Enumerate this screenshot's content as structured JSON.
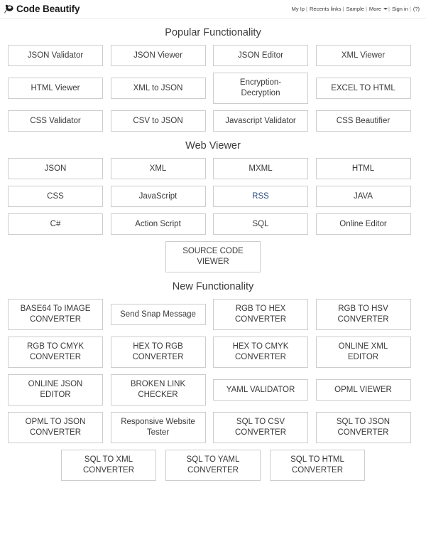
{
  "header": {
    "brand": "Code Beautify",
    "logo_icon": "paw-speech-bubble-icon",
    "nav": [
      {
        "label": "My Ip",
        "sep": "|"
      },
      {
        "label": "Recents links",
        "sep": "|"
      },
      {
        "label": "Sample",
        "sep": "|"
      },
      {
        "label": "More",
        "sep": "|",
        "caret": true
      },
      {
        "label": "Sign in",
        "sep": "|"
      },
      {
        "label": "(?)",
        "sep": ""
      }
    ]
  },
  "sections": [
    {
      "title": "Popular Functionality",
      "rows": [
        {
          "align": "left",
          "items": [
            {
              "label": "JSON Validator",
              "lines": 1
            },
            {
              "label": "JSON Viewer",
              "lines": 1
            },
            {
              "label": "JSON Editor",
              "lines": 1
            },
            {
              "label": "XML Viewer",
              "lines": 1
            }
          ]
        },
        {
          "align": "left",
          "items": [
            {
              "label": "HTML Viewer",
              "lines": 1
            },
            {
              "label": "XML to JSON",
              "lines": 1
            },
            {
              "label": "Encryption-\nDecryption",
              "lines": 2
            },
            {
              "label": "EXCEL TO HTML",
              "lines": 1
            }
          ]
        },
        {
          "align": "left",
          "items": [
            {
              "label": "CSS Validator",
              "lines": 1
            },
            {
              "label": "CSV to JSON",
              "lines": 1
            },
            {
              "label": "Javascript Validator",
              "lines": 1
            },
            {
              "label": "CSS Beautifier",
              "lines": 1
            }
          ]
        }
      ]
    },
    {
      "title": "Web Viewer",
      "rows": [
        {
          "align": "left",
          "items": [
            {
              "label": "JSON",
              "lines": 1
            },
            {
              "label": "XML",
              "lines": 1
            },
            {
              "label": "MXML",
              "lines": 1
            },
            {
              "label": "HTML",
              "lines": 1
            }
          ]
        },
        {
          "align": "left",
          "items": [
            {
              "label": "CSS",
              "lines": 1
            },
            {
              "label": "JavaScript",
              "lines": 1
            },
            {
              "label": "RSS",
              "lines": 1,
              "color": "link"
            },
            {
              "label": "JAVA",
              "lines": 1
            }
          ]
        },
        {
          "align": "left",
          "items": [
            {
              "label": "C#",
              "lines": 1
            },
            {
              "label": "Action Script",
              "lines": 1
            },
            {
              "label": "SQL",
              "lines": 1
            },
            {
              "label": "Online Editor",
              "lines": 1
            }
          ]
        },
        {
          "align": "center",
          "items": [
            {
              "label": "SOURCE CODE\nVIEWER",
              "lines": 2
            }
          ]
        }
      ]
    },
    {
      "title": "New Functionality",
      "rows": [
        {
          "align": "left",
          "items": [
            {
              "label": "BASE64 To IMAGE\nCONVERTER",
              "lines": 2
            },
            {
              "label": "Send Snap Message",
              "lines": 1
            },
            {
              "label": "RGB TO HEX\nCONVERTER",
              "lines": 2
            },
            {
              "label": "RGB TO HSV\nCONVERTER",
              "lines": 2
            }
          ]
        },
        {
          "align": "left",
          "items": [
            {
              "label": "RGB TO CMYK\nCONVERTER",
              "lines": 2
            },
            {
              "label": "HEX TO RGB\nCONVERTER",
              "lines": 2
            },
            {
              "label": "HEX TO CMYK\nCONVERTER",
              "lines": 2
            },
            {
              "label": "ONLINE XML\nEDITOR",
              "lines": 2
            }
          ]
        },
        {
          "align": "left",
          "items": [
            {
              "label": "ONLINE JSON\nEDITOR",
              "lines": 2
            },
            {
              "label": "BROKEN LINK\nCHECKER",
              "lines": 2
            },
            {
              "label": "YAML VALIDATOR",
              "lines": 1
            },
            {
              "label": "OPML VIEWER",
              "lines": 1
            }
          ]
        },
        {
          "align": "left",
          "items": [
            {
              "label": "OPML TO JSON\nCONVERTER",
              "lines": 2
            },
            {
              "label": "Responsive Website\nTester",
              "lines": 2
            },
            {
              "label": "SQL TO CSV\nCONVERTER",
              "lines": 2
            },
            {
              "label": "SQL TO JSON\nCONVERTER",
              "lines": 2
            }
          ]
        },
        {
          "align": "center",
          "items": [
            {
              "label": "SQL TO XML\nCONVERTER",
              "lines": 2
            },
            {
              "label": "SQL TO YAML\nCONVERTER",
              "lines": 2
            },
            {
              "label": "SQL TO HTML\nCONVERTER",
              "lines": 2
            }
          ]
        }
      ]
    }
  ],
  "colors": {
    "border": "#cdcdcd",
    "text": "#3a3a3a",
    "heading": "#3c3c3c",
    "link": "#24497f",
    "divider": "#ececec"
  }
}
